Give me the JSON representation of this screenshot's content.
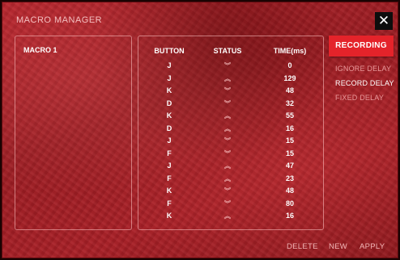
{
  "window": {
    "title": "MACRO MANAGER",
    "close_icon": "close-icon",
    "close_glyph": "✕"
  },
  "macros": {
    "items": [
      "MACRO 1"
    ]
  },
  "table": {
    "headers": {
      "button": "BUTTON",
      "status": "STATUS",
      "time": "TIME(ms)"
    },
    "rows": [
      {
        "button": "J",
        "status": "down",
        "time": "0"
      },
      {
        "button": "J",
        "status": "up",
        "time": "129"
      },
      {
        "button": "K",
        "status": "down",
        "time": "48"
      },
      {
        "button": "D",
        "status": "down",
        "time": "32"
      },
      {
        "button": "K",
        "status": "up",
        "time": "55"
      },
      {
        "button": "D",
        "status": "up",
        "time": "16"
      },
      {
        "button": "J",
        "status": "down",
        "time": "15"
      },
      {
        "button": "F",
        "status": "down",
        "time": "15"
      },
      {
        "button": "J",
        "status": "up",
        "time": "47"
      },
      {
        "button": "F",
        "status": "up",
        "time": "23"
      },
      {
        "button": "K",
        "status": "down",
        "time": "48"
      },
      {
        "button": "F",
        "status": "down",
        "time": "80"
      },
      {
        "button": "K",
        "status": "up",
        "time": "16"
      }
    ],
    "status_glyphs": {
      "down": "︾",
      "up": "︽"
    },
    "status_icons": {
      "down": "double-chevron-down-icon",
      "up": "double-chevron-up-icon"
    }
  },
  "options": {
    "record_label": "RECORDING",
    "delay_options": [
      "IGNORE DELAY",
      "RECORD DELAY",
      "FIXED DELAY"
    ],
    "selected_delay": "RECORD DELAY"
  },
  "footer": {
    "delete_label": "DELETE",
    "new_label": "NEW",
    "apply_label": "APPLY"
  },
  "colors": {
    "accent": "#e4232a",
    "background": "#a91f26",
    "text": "#ffffff"
  }
}
